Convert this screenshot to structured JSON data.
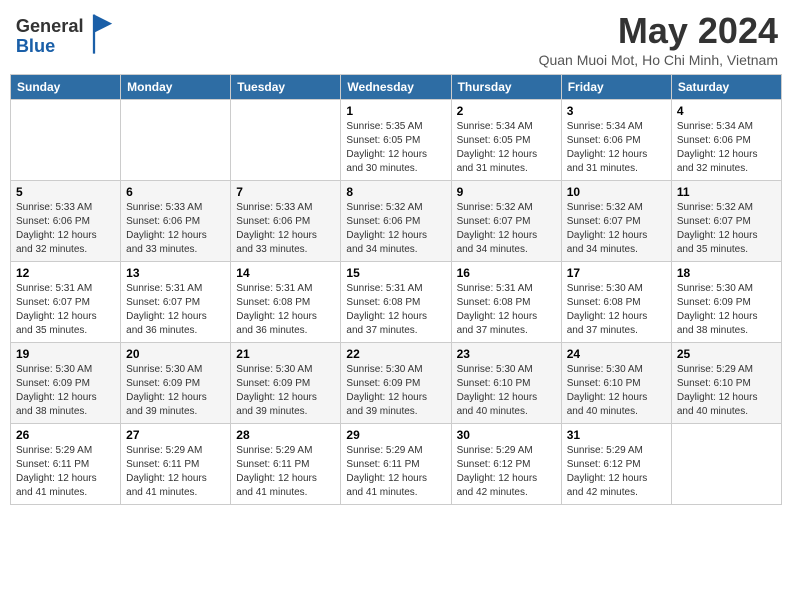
{
  "header": {
    "logo": {
      "general": "General",
      "blue": "Blue",
      "tagline": ""
    },
    "title": "May 2024",
    "location": "Quan Muoi Mot, Ho Chi Minh, Vietnam"
  },
  "calendar": {
    "days_of_week": [
      "Sunday",
      "Monday",
      "Tuesday",
      "Wednesday",
      "Thursday",
      "Friday",
      "Saturday"
    ],
    "weeks": [
      {
        "row_shade": false,
        "days": [
          {
            "num": "",
            "info": ""
          },
          {
            "num": "",
            "info": ""
          },
          {
            "num": "",
            "info": ""
          },
          {
            "num": "1",
            "info": "Sunrise: 5:35 AM\nSunset: 6:05 PM\nDaylight: 12 hours\nand 30 minutes."
          },
          {
            "num": "2",
            "info": "Sunrise: 5:34 AM\nSunset: 6:05 PM\nDaylight: 12 hours\nand 31 minutes."
          },
          {
            "num": "3",
            "info": "Sunrise: 5:34 AM\nSunset: 6:06 PM\nDaylight: 12 hours\nand 31 minutes."
          },
          {
            "num": "4",
            "info": "Sunrise: 5:34 AM\nSunset: 6:06 PM\nDaylight: 12 hours\nand 32 minutes."
          }
        ]
      },
      {
        "row_shade": true,
        "days": [
          {
            "num": "5",
            "info": "Sunrise: 5:33 AM\nSunset: 6:06 PM\nDaylight: 12 hours\nand 32 minutes."
          },
          {
            "num": "6",
            "info": "Sunrise: 5:33 AM\nSunset: 6:06 PM\nDaylight: 12 hours\nand 33 minutes."
          },
          {
            "num": "7",
            "info": "Sunrise: 5:33 AM\nSunset: 6:06 PM\nDaylight: 12 hours\nand 33 minutes."
          },
          {
            "num": "8",
            "info": "Sunrise: 5:32 AM\nSunset: 6:06 PM\nDaylight: 12 hours\nand 34 minutes."
          },
          {
            "num": "9",
            "info": "Sunrise: 5:32 AM\nSunset: 6:07 PM\nDaylight: 12 hours\nand 34 minutes."
          },
          {
            "num": "10",
            "info": "Sunrise: 5:32 AM\nSunset: 6:07 PM\nDaylight: 12 hours\nand 34 minutes."
          },
          {
            "num": "11",
            "info": "Sunrise: 5:32 AM\nSunset: 6:07 PM\nDaylight: 12 hours\nand 35 minutes."
          }
        ]
      },
      {
        "row_shade": false,
        "days": [
          {
            "num": "12",
            "info": "Sunrise: 5:31 AM\nSunset: 6:07 PM\nDaylight: 12 hours\nand 35 minutes."
          },
          {
            "num": "13",
            "info": "Sunrise: 5:31 AM\nSunset: 6:07 PM\nDaylight: 12 hours\nand 36 minutes."
          },
          {
            "num": "14",
            "info": "Sunrise: 5:31 AM\nSunset: 6:08 PM\nDaylight: 12 hours\nand 36 minutes."
          },
          {
            "num": "15",
            "info": "Sunrise: 5:31 AM\nSunset: 6:08 PM\nDaylight: 12 hours\nand 37 minutes."
          },
          {
            "num": "16",
            "info": "Sunrise: 5:31 AM\nSunset: 6:08 PM\nDaylight: 12 hours\nand 37 minutes."
          },
          {
            "num": "17",
            "info": "Sunrise: 5:30 AM\nSunset: 6:08 PM\nDaylight: 12 hours\nand 37 minutes."
          },
          {
            "num": "18",
            "info": "Sunrise: 5:30 AM\nSunset: 6:09 PM\nDaylight: 12 hours\nand 38 minutes."
          }
        ]
      },
      {
        "row_shade": true,
        "days": [
          {
            "num": "19",
            "info": "Sunrise: 5:30 AM\nSunset: 6:09 PM\nDaylight: 12 hours\nand 38 minutes."
          },
          {
            "num": "20",
            "info": "Sunrise: 5:30 AM\nSunset: 6:09 PM\nDaylight: 12 hours\nand 39 minutes."
          },
          {
            "num": "21",
            "info": "Sunrise: 5:30 AM\nSunset: 6:09 PM\nDaylight: 12 hours\nand 39 minutes."
          },
          {
            "num": "22",
            "info": "Sunrise: 5:30 AM\nSunset: 6:09 PM\nDaylight: 12 hours\nand 39 minutes."
          },
          {
            "num": "23",
            "info": "Sunrise: 5:30 AM\nSunset: 6:10 PM\nDaylight: 12 hours\nand 40 minutes."
          },
          {
            "num": "24",
            "info": "Sunrise: 5:30 AM\nSunset: 6:10 PM\nDaylight: 12 hours\nand 40 minutes."
          },
          {
            "num": "25",
            "info": "Sunrise: 5:29 AM\nSunset: 6:10 PM\nDaylight: 12 hours\nand 40 minutes."
          }
        ]
      },
      {
        "row_shade": false,
        "days": [
          {
            "num": "26",
            "info": "Sunrise: 5:29 AM\nSunset: 6:11 PM\nDaylight: 12 hours\nand 41 minutes."
          },
          {
            "num": "27",
            "info": "Sunrise: 5:29 AM\nSunset: 6:11 PM\nDaylight: 12 hours\nand 41 minutes."
          },
          {
            "num": "28",
            "info": "Sunrise: 5:29 AM\nSunset: 6:11 PM\nDaylight: 12 hours\nand 41 minutes."
          },
          {
            "num": "29",
            "info": "Sunrise: 5:29 AM\nSunset: 6:11 PM\nDaylight: 12 hours\nand 41 minutes."
          },
          {
            "num": "30",
            "info": "Sunrise: 5:29 AM\nSunset: 6:12 PM\nDaylight: 12 hours\nand 42 minutes."
          },
          {
            "num": "31",
            "info": "Sunrise: 5:29 AM\nSunset: 6:12 PM\nDaylight: 12 hours\nand 42 minutes."
          },
          {
            "num": "",
            "info": ""
          }
        ]
      }
    ]
  }
}
